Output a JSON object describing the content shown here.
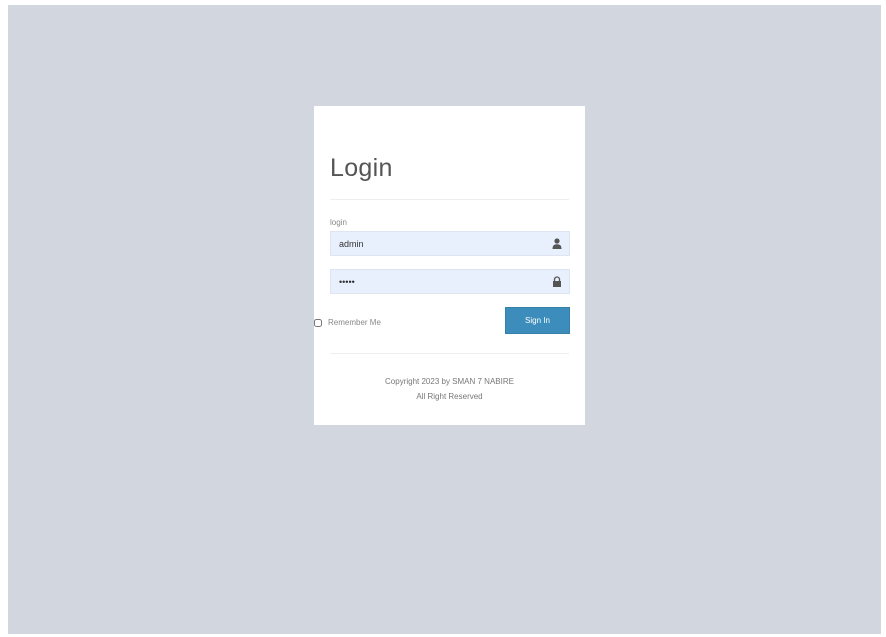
{
  "login": {
    "title": "Login",
    "field_label": "login",
    "username_value": "admin",
    "password_value": "•••••",
    "remember_label": "Remember Me",
    "signin_label": "Sign In",
    "copyright_line1": "Copyright 2023 by SMAN 7 NABIRE",
    "copyright_line2": "All Right Reserved",
    "icons": {
      "username": "user-icon",
      "password": "lock-icon"
    }
  },
  "colors": {
    "page_background": "#d2d6de",
    "card_background": "#ffffff",
    "input_background": "#e8f0fe",
    "button_background": "#3c8dbc"
  }
}
